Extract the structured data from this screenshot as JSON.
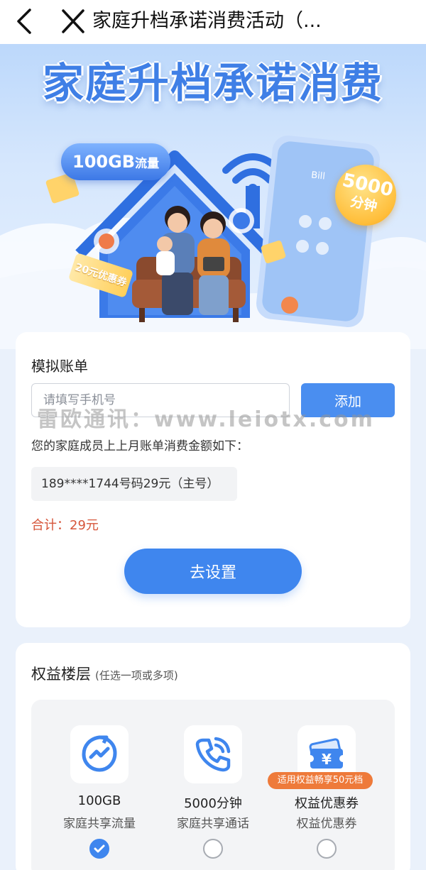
{
  "nav": {
    "title": "家庭升档承诺消费活动（..."
  },
  "hero": {
    "title": "家庭升档承诺消费",
    "bubble_value": "100GB",
    "bubble_unit": "流量",
    "badge_value": "5000",
    "badge_unit": "分钟",
    "coupon_text": "20元优惠券",
    "phone_caller": "Bill"
  },
  "bill": {
    "title": "模拟账单",
    "input_placeholder": "请填写手机号",
    "input_value": "",
    "add_label": "添加",
    "watermark": "雷欧通讯：www.leiotx.com",
    "description": "您的家庭成员上上月账单消费金额如下：",
    "members": [
      {
        "text": "189****1744号码29元（主号）"
      }
    ],
    "total": "合计：29元",
    "set_label": "去设置"
  },
  "rights": {
    "title": "权益楼层",
    "hint": "(任选一项或多项)",
    "options": [
      {
        "name": "100GB",
        "sub": "家庭共享流量",
        "icon": "data-flow-icon",
        "checked": true,
        "tag": ""
      },
      {
        "name": "5000分钟",
        "sub": "家庭共享通话",
        "icon": "phone-call-icon",
        "checked": false,
        "tag": ""
      },
      {
        "name": "权益优惠券",
        "sub": "权益优惠券",
        "icon": "coupon-icon",
        "checked": false,
        "tag": "适用权益畅享50元档"
      }
    ]
  },
  "colors": {
    "accent": "#3f86ee",
    "total_red": "#d6553a",
    "tag_orange": "#ee7a3a"
  }
}
